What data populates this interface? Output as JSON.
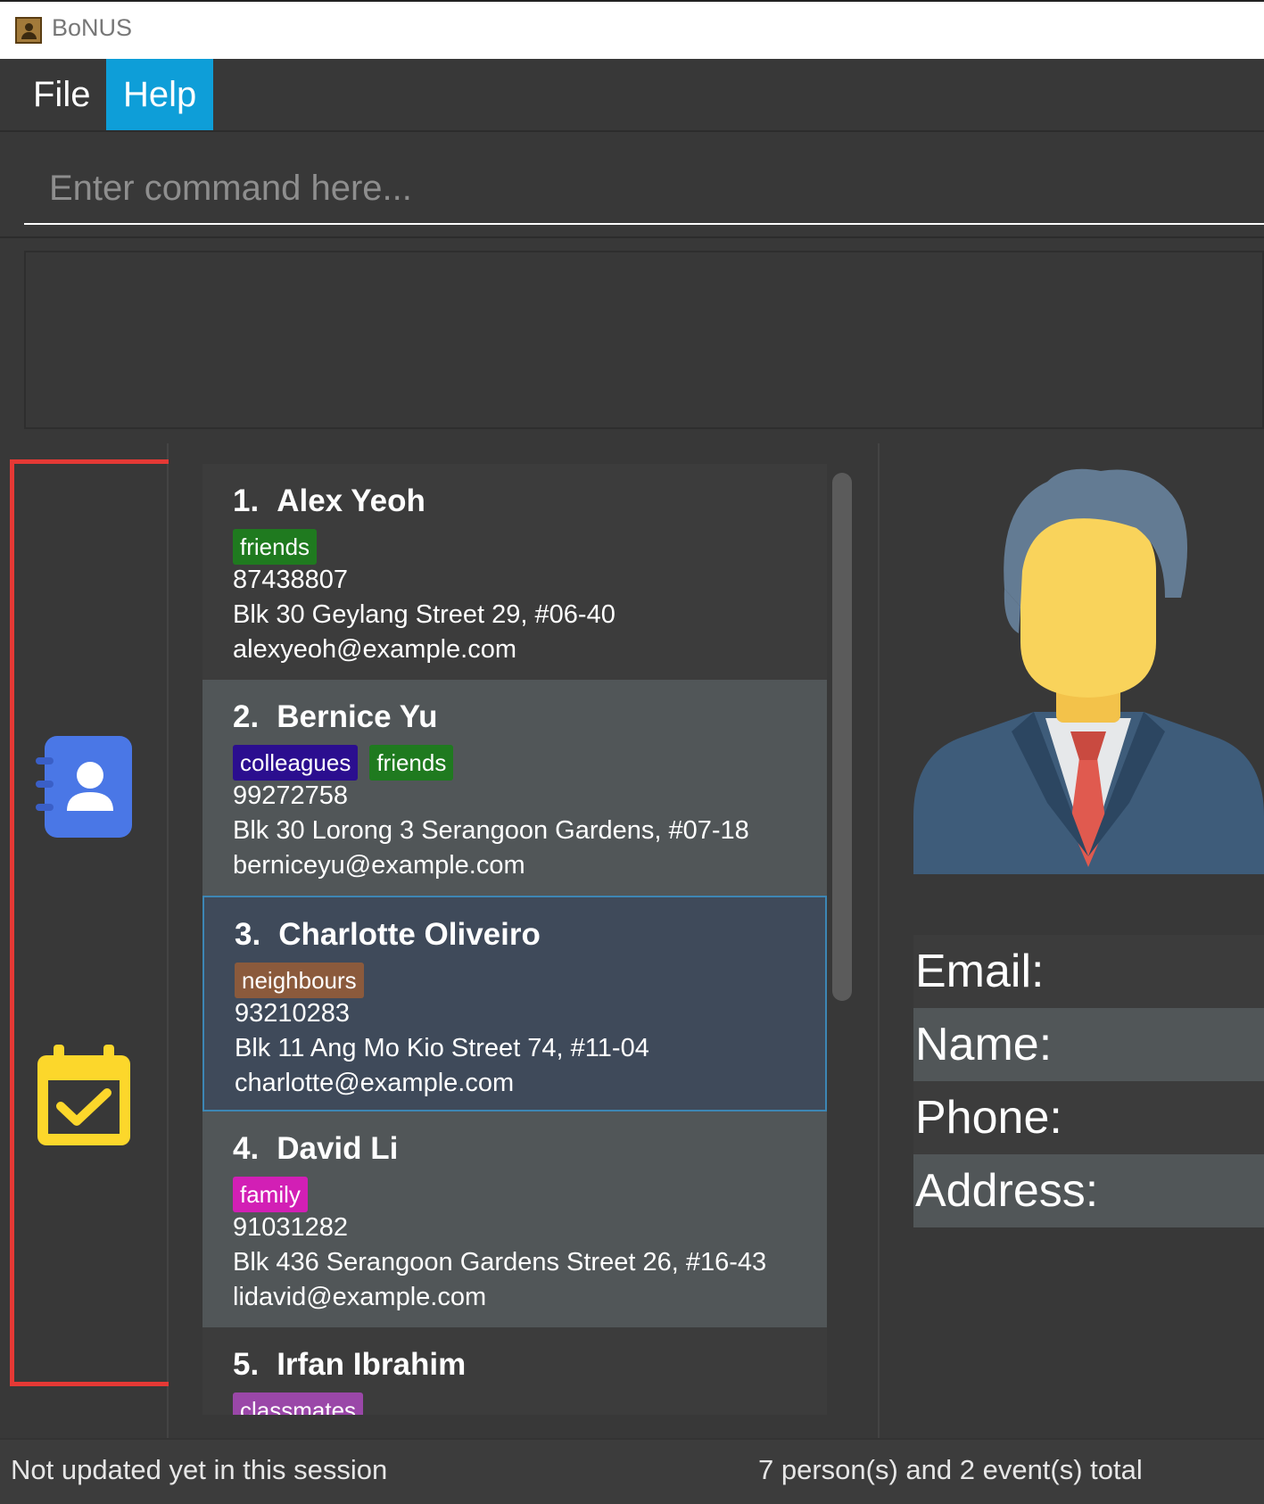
{
  "window": {
    "title": "BoNUS",
    "icon": "address-book-app-icon"
  },
  "menu": {
    "items": [
      {
        "label": "File"
      },
      {
        "label": "Help",
        "active": true
      }
    ]
  },
  "command": {
    "placeholder": "Enter command here...",
    "value": ""
  },
  "result": {
    "text": ""
  },
  "sidebar": {
    "items": [
      {
        "name": "contacts",
        "icon": "contacts-book-icon",
        "color": "#4a77e6"
      },
      {
        "name": "events",
        "icon": "calendar-check-icon",
        "color": "#fcd72b"
      }
    ],
    "highlight_color": "#e53935"
  },
  "persons": [
    {
      "index": "1.",
      "name": "Alex Yeoh",
      "tags": [
        {
          "label": "friends",
          "color": "#1f7a1f"
        }
      ],
      "phone": "87438807",
      "address": "Blk 30 Geylang Street 29, #06-40",
      "email": "alexyeoh@example.com"
    },
    {
      "index": "2.",
      "name": "Bernice Yu",
      "tags": [
        {
          "label": "colleagues",
          "color": "#2b0e8f"
        },
        {
          "label": "friends",
          "color": "#1f7a1f"
        }
      ],
      "phone": "99272758",
      "address": "Blk 30 Lorong 3 Serangoon Gardens, #07-18",
      "email": "berniceyu@example.com"
    },
    {
      "index": "3.",
      "name": "Charlotte Oliveiro",
      "tags": [
        {
          "label": "neighbours",
          "color": "#8b5a3c"
        }
      ],
      "phone": "93210283",
      "address": "Blk 11 Ang Mo Kio Street 74, #11-04",
      "email": "charlotte@example.com",
      "selected": true
    },
    {
      "index": "4.",
      "name": "David Li",
      "tags": [
        {
          "label": "family",
          "color": "#d21fb5"
        }
      ],
      "phone": "91031282",
      "address": "Blk 436 Serangoon Gardens Street 26, #16-43",
      "email": "lidavid@example.com"
    },
    {
      "index": "5.",
      "name": "Irfan Ibrahim",
      "tags": [
        {
          "label": "classmates",
          "color": "#9a47a8"
        }
      ],
      "phone": "",
      "address": "",
      "email": ""
    }
  ],
  "detail": {
    "avatar": "person-avatar-icon",
    "fields": [
      {
        "label": "Email:"
      },
      {
        "label": "Name:"
      },
      {
        "label": "Phone:"
      },
      {
        "label": "Address:"
      }
    ]
  },
  "status": {
    "left": "Not updated yet in this session",
    "right": "7 person(s) and 2 event(s) total"
  }
}
